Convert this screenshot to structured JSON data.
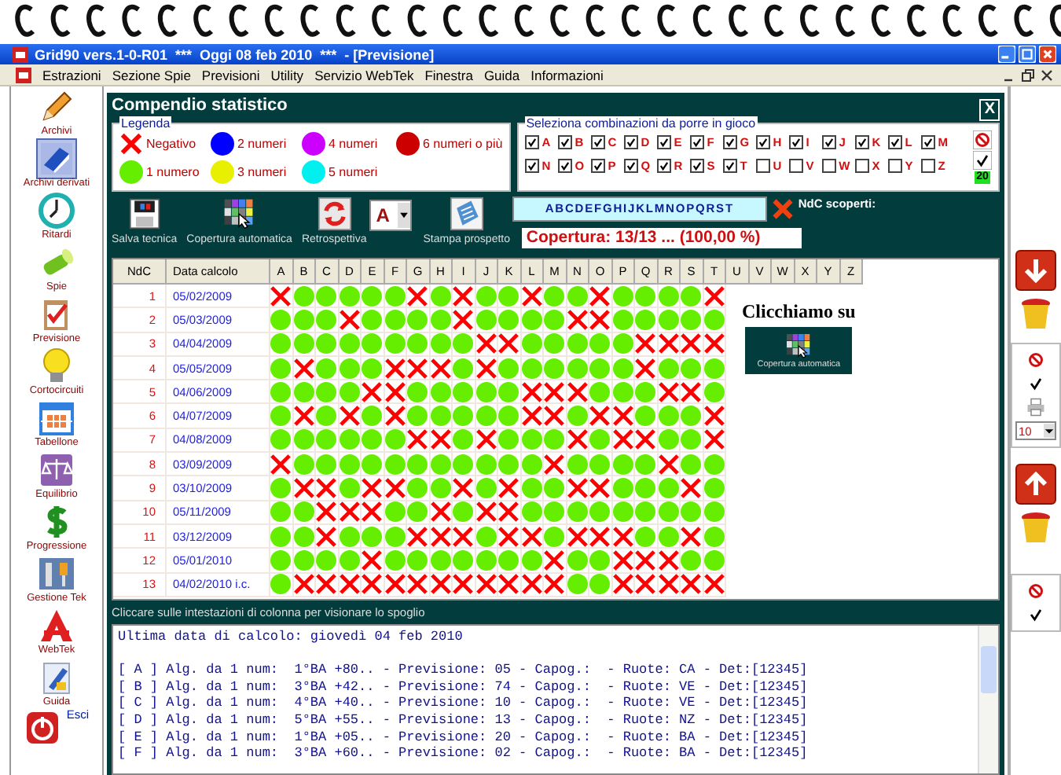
{
  "window": {
    "title": "Grid90 vers.1-0-R01  ***  Oggi 08 feb 2010  ***  - [Previsione]"
  },
  "menu": [
    "Estrazioni",
    "Sezione Spie",
    "Previsioni",
    "Utility",
    "Servizio WebTek",
    "Finestra",
    "Guida",
    "Informazioni"
  ],
  "sidebar": {
    "items": [
      {
        "label": "Archivi",
        "selected": false
      },
      {
        "label": "Archivi derivati",
        "selected": true
      },
      {
        "label": "Ritardi",
        "selected": false
      },
      {
        "label": "Spie",
        "selected": false
      },
      {
        "label": "Previsione",
        "selected": false
      },
      {
        "label": "Cortocircuiti",
        "selected": false
      },
      {
        "label": "Tabellone",
        "selected": false
      },
      {
        "label": "Equilibrio",
        "selected": false
      },
      {
        "label": "Progressione",
        "selected": false
      },
      {
        "label": "Gestione Tek",
        "selected": false
      },
      {
        "label": "WebTek",
        "selected": false
      },
      {
        "label": "Guida",
        "selected": false
      },
      {
        "label": "Esci",
        "selected": false
      }
    ]
  },
  "panel": {
    "title": "Compendio statistico",
    "close": "X"
  },
  "legend": {
    "title": "Legenda",
    "items": [
      {
        "label": "Negativo",
        "kind": "cross",
        "color": "#ff0000"
      },
      {
        "label": "2 numeri",
        "kind": "dot",
        "color": "#0000ff"
      },
      {
        "label": "4 numeri",
        "kind": "dot",
        "color": "#cc00ff"
      },
      {
        "label": "6 numeri o più",
        "kind": "dot",
        "color": "#cc0000"
      },
      {
        "label": "1 numero",
        "kind": "dot",
        "color": "#66ee00"
      },
      {
        "label": "3 numeri",
        "kind": "dot",
        "color": "#e8f000"
      },
      {
        "label": "5 numeri",
        "kind": "dot",
        "color": "#00f0f0"
      }
    ]
  },
  "combos": {
    "title": "Seleziona combinazioni da porre in gioco",
    "count": "20",
    "options": [
      {
        "letter": "A",
        "checked": true
      },
      {
        "letter": "B",
        "checked": true
      },
      {
        "letter": "C",
        "checked": true
      },
      {
        "letter": "D",
        "checked": true
      },
      {
        "letter": "E",
        "checked": true
      },
      {
        "letter": "F",
        "checked": true
      },
      {
        "letter": "G",
        "checked": true
      },
      {
        "letter": "H",
        "checked": true
      },
      {
        "letter": "I",
        "checked": true
      },
      {
        "letter": "J",
        "checked": true
      },
      {
        "letter": "K",
        "checked": true
      },
      {
        "letter": "L",
        "checked": true
      },
      {
        "letter": "M",
        "checked": true
      },
      {
        "letter": "N",
        "checked": true
      },
      {
        "letter": "O",
        "checked": true
      },
      {
        "letter": "P",
        "checked": true
      },
      {
        "letter": "Q",
        "checked": true
      },
      {
        "letter": "R",
        "checked": true
      },
      {
        "letter": "S",
        "checked": true
      },
      {
        "letter": "T",
        "checked": true
      },
      {
        "letter": "U",
        "checked": false
      },
      {
        "letter": "V",
        "checked": false
      },
      {
        "letter": "W",
        "checked": false
      },
      {
        "letter": "X",
        "checked": false
      },
      {
        "letter": "Y",
        "checked": false
      },
      {
        "letter": "Z",
        "checked": false
      }
    ]
  },
  "toolbar": {
    "buttons": [
      "Salva tecnica",
      "Copertura automatica",
      "Retrospettiva",
      "Stampa prospetto"
    ],
    "select_value": "A",
    "letters": "ABCDEFGHIJKLMNOPQRST",
    "uncovered_label": "NdC scoperti:",
    "coverage": "Copertura: 13/13 ... (100,00 %)"
  },
  "table": {
    "columns": [
      "NdC",
      "Data calcolo",
      "A",
      "B",
      "C",
      "D",
      "E",
      "F",
      "G",
      "H",
      "I",
      "J",
      "K",
      "L",
      "M",
      "N",
      "O",
      "P",
      "Q",
      "R",
      "S",
      "T",
      "U",
      "V",
      "W",
      "X",
      "Y",
      "Z"
    ],
    "rows": [
      {
        "ndc": "1",
        "date": "05/02/2009",
        "negative": [
          true,
          false,
          false,
          false,
          false,
          false,
          true,
          false,
          true,
          false,
          false,
          true,
          false,
          false,
          true,
          false,
          false,
          false,
          false,
          true
        ]
      },
      {
        "ndc": "2",
        "date": "05/03/2009",
        "negative": [
          false,
          false,
          false,
          true,
          false,
          false,
          false,
          false,
          true,
          false,
          false,
          false,
          false,
          true,
          true,
          false,
          false,
          false,
          false,
          false
        ]
      },
      {
        "ndc": "3",
        "date": "04/04/2009",
        "negative": [
          false,
          false,
          false,
          false,
          false,
          false,
          false,
          false,
          false,
          true,
          true,
          false,
          false,
          false,
          false,
          false,
          true,
          true,
          true,
          true
        ]
      },
      {
        "ndc": "4",
        "date": "05/05/2009",
        "negative": [
          false,
          true,
          false,
          false,
          false,
          true,
          true,
          true,
          false,
          true,
          false,
          false,
          false,
          false,
          false,
          false,
          true,
          false,
          false,
          false
        ]
      },
      {
        "ndc": "5",
        "date": "04/06/2009",
        "negative": [
          false,
          false,
          false,
          false,
          true,
          true,
          false,
          false,
          false,
          false,
          false,
          true,
          true,
          true,
          false,
          false,
          false,
          true,
          true,
          false
        ]
      },
      {
        "ndc": "6",
        "date": "04/07/2009",
        "negative": [
          false,
          true,
          false,
          true,
          false,
          true,
          false,
          false,
          false,
          false,
          false,
          true,
          true,
          false,
          true,
          true,
          false,
          false,
          false,
          true
        ]
      },
      {
        "ndc": "7",
        "date": "04/08/2009",
        "negative": [
          false,
          false,
          false,
          false,
          false,
          false,
          true,
          true,
          false,
          true,
          false,
          false,
          false,
          true,
          false,
          true,
          true,
          false,
          false,
          true
        ]
      },
      {
        "ndc": "8",
        "date": "03/09/2009",
        "negative": [
          true,
          false,
          false,
          false,
          false,
          false,
          false,
          false,
          false,
          false,
          false,
          false,
          true,
          false,
          false,
          false,
          false,
          true,
          false,
          false
        ]
      },
      {
        "ndc": "9",
        "date": "03/10/2009",
        "negative": [
          false,
          true,
          true,
          false,
          true,
          true,
          false,
          false,
          true,
          false,
          true,
          false,
          false,
          true,
          true,
          false,
          false,
          false,
          true,
          false
        ]
      },
      {
        "ndc": "10",
        "date": "05/11/2009",
        "negative": [
          false,
          false,
          true,
          true,
          true,
          false,
          false,
          true,
          false,
          true,
          true,
          false,
          false,
          false,
          false,
          false,
          false,
          false,
          false,
          false
        ]
      },
      {
        "ndc": "11",
        "date": "03/12/2009",
        "negative": [
          false,
          false,
          true,
          false,
          false,
          false,
          true,
          true,
          true,
          false,
          true,
          true,
          false,
          true,
          true,
          true,
          false,
          false,
          true,
          false
        ]
      },
      {
        "ndc": "12",
        "date": "05/01/2010",
        "negative": [
          false,
          false,
          false,
          false,
          true,
          false,
          false,
          false,
          false,
          false,
          false,
          false,
          true,
          false,
          false,
          true,
          true,
          true,
          false,
          false
        ]
      },
      {
        "ndc": "13",
        "date": "04/02/2010 i.c.",
        "negative": [
          false,
          true,
          true,
          true,
          true,
          true,
          true,
          true,
          true,
          true,
          true,
          true,
          true,
          false,
          false,
          true,
          true,
          true,
          true,
          true
        ]
      }
    ]
  },
  "overlay": {
    "text": "Clicchiamo su",
    "label": "Copertura automatica"
  },
  "hint": "Cliccare sulle intestazioni di colonna per visionare lo spoglio",
  "report": [
    "Ultima data di calcolo: giovedì 04 feb 2010",
    "[ A ] Alg. da 1 num:  1°BA +80.. - Previsione: 05 - Capog.:  - Ruote: CA - Det:[12345]",
    "[ B ] Alg. da 1 num:  3°BA +42.. - Previsione: 74 - Capog.:  - Ruote: VE - Det:[12345]",
    "[ C ] Alg. da 1 num:  4°BA +40.. - Previsione: 10 - Capog.:  - Ruote: VE - Det:[12345]",
    "[ D ] Alg. da 1 num:  5°BA +55.. - Previsione: 13 - Capog.:  - Ruote: NZ - Det:[12345]",
    "[ E ] Alg. da 1 num:  1°BA +05.. - Previsione: 20 - Capog.:  - Ruote: BA - Det:[12345]",
    "[ F ] Alg. da 1 num:  3°BA +60.. - Previsione: 02 - Capog.:  - Ruote: BA - Det:[12345]"
  ],
  "right_panel": {
    "page_size": "10"
  }
}
